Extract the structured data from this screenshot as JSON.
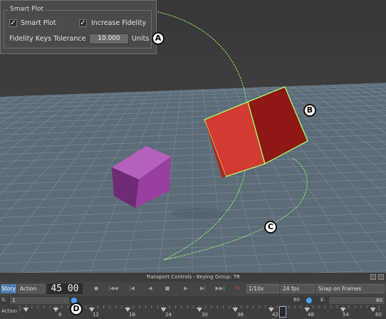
{
  "smart_plot": {
    "title": "Smart Plot",
    "smart_plot_label": "Smart Plot",
    "smart_plot_checked": true,
    "increase_fidelity_label": "Increase Fidelity",
    "increase_fidelity_checked": true,
    "tolerance_label": "Fidelity Keys Tolerance",
    "tolerance_value": "10.000",
    "units_label": "Units"
  },
  "callouts": [
    "A",
    "B",
    "C",
    "D"
  ],
  "transport": {
    "title": "Transport Controls - Keying Group: TR",
    "story_label": "Story",
    "mode": "Action",
    "frame": "45 00",
    "speed": "1/10x",
    "fps": "24 fps",
    "snap": "Snap on Frames",
    "s_label": "S:",
    "s_value": "1",
    "e_label": "E:",
    "e_value": "60",
    "range_end": "60",
    "action_label": "Action",
    "ticks": [
      "6",
      "12",
      "18",
      "24",
      "30",
      "36",
      "42",
      "48",
      "54",
      "60"
    ]
  },
  "colors": {
    "viewport_bg": "#3b3b3b",
    "floor": "#5b6b78",
    "selection": "#a8ff6e",
    "red_cube": "#c8302a",
    "purple_cube": "#9a3da0",
    "story_button": "#4f7bb0"
  }
}
